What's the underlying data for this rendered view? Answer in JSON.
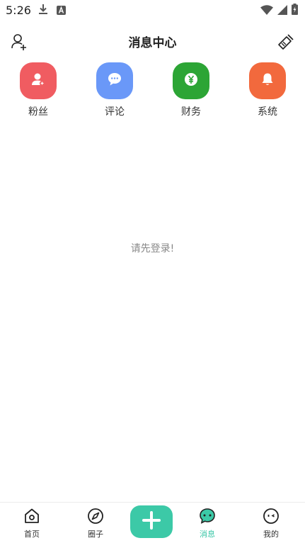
{
  "status_bar": {
    "time": "5:26",
    "icons": [
      "download-icon",
      "keyboard-a-icon",
      "wifi-icon",
      "signal-icon",
      "battery-charging-icon"
    ]
  },
  "header": {
    "title": "消息中心",
    "left_icon": "add-user-icon",
    "right_icon": "broom-icon"
  },
  "categories": [
    {
      "label": "粉丝",
      "icon": "user-plus-icon",
      "color": "#f05c61"
    },
    {
      "label": "评论",
      "icon": "chat-bubble-icon",
      "color": "#6a98f8"
    },
    {
      "label": "财务",
      "icon": "yen-coin-icon",
      "color": "#2ca535"
    },
    {
      "label": "系统",
      "icon": "bell-icon",
      "color": "#f2693d"
    }
  ],
  "main": {
    "empty_message": "请先登录!"
  },
  "bottom_nav": {
    "items": [
      {
        "label": "首页",
        "icon": "home-icon",
        "active": false
      },
      {
        "label": "圈子",
        "icon": "compass-icon",
        "active": false
      },
      {
        "label": "消息",
        "icon": "message-icon",
        "active": true
      },
      {
        "label": "我的",
        "icon": "profile-face-icon",
        "active": false
      }
    ],
    "publish_icon": "plus-icon",
    "accent": "#3cc9a7"
  }
}
